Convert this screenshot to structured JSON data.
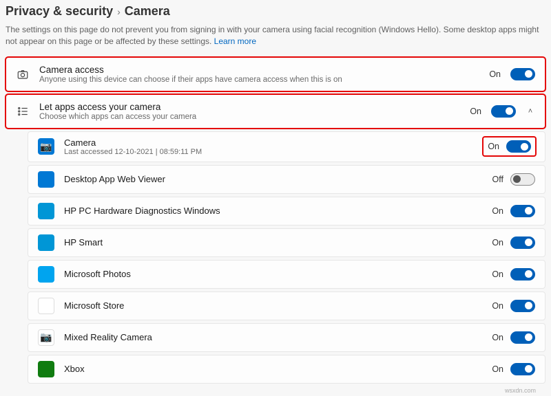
{
  "breadcrumb": {
    "parent": "Privacy & security",
    "sep": "›",
    "current": "Camera"
  },
  "description": {
    "text": "The settings on this page do not prevent you from signing in with your camera using facial recognition (Windows Hello). Some desktop apps might not appear on this page or be affected by these settings.  ",
    "link": "Learn more"
  },
  "panels": {
    "cameraAccess": {
      "title": "Camera access",
      "sub": "Anyone using this device can choose if their apps have camera access when this is on",
      "state": "On"
    },
    "letApps": {
      "title": "Let apps access your camera",
      "sub": "Choose which apps can access your camera",
      "state": "On"
    }
  },
  "apps": [
    {
      "name": "Camera",
      "sub": "Last accessed 12-10-2021  |  08:59:11 PM",
      "state": "On",
      "on": true,
      "highlight": true,
      "iconClass": "",
      "glyph": "📷"
    },
    {
      "name": "Desktop App Web Viewer",
      "sub": "",
      "state": "Off",
      "on": false,
      "highlight": false,
      "iconClass": "",
      "glyph": ""
    },
    {
      "name": "HP PC Hardware Diagnostics Windows",
      "sub": "",
      "state": "On",
      "on": true,
      "highlight": false,
      "iconClass": "hp",
      "glyph": ""
    },
    {
      "name": "HP Smart",
      "sub": "",
      "state": "On",
      "on": true,
      "highlight": false,
      "iconClass": "hp",
      "glyph": ""
    },
    {
      "name": "Microsoft Photos",
      "sub": "",
      "state": "On",
      "on": true,
      "highlight": false,
      "iconClass": "cyan",
      "glyph": ""
    },
    {
      "name": "Microsoft Store",
      "sub": "",
      "state": "On",
      "on": true,
      "highlight": false,
      "iconClass": "white-box",
      "glyph": "🛍"
    },
    {
      "name": "Mixed Reality Camera",
      "sub": "",
      "state": "On",
      "on": true,
      "highlight": false,
      "iconClass": "white-box",
      "glyph": "📷"
    },
    {
      "name": "Xbox",
      "sub": "",
      "state": "On",
      "on": true,
      "highlight": false,
      "iconClass": "green",
      "glyph": ""
    }
  ],
  "watermark": "wsxdn.com"
}
